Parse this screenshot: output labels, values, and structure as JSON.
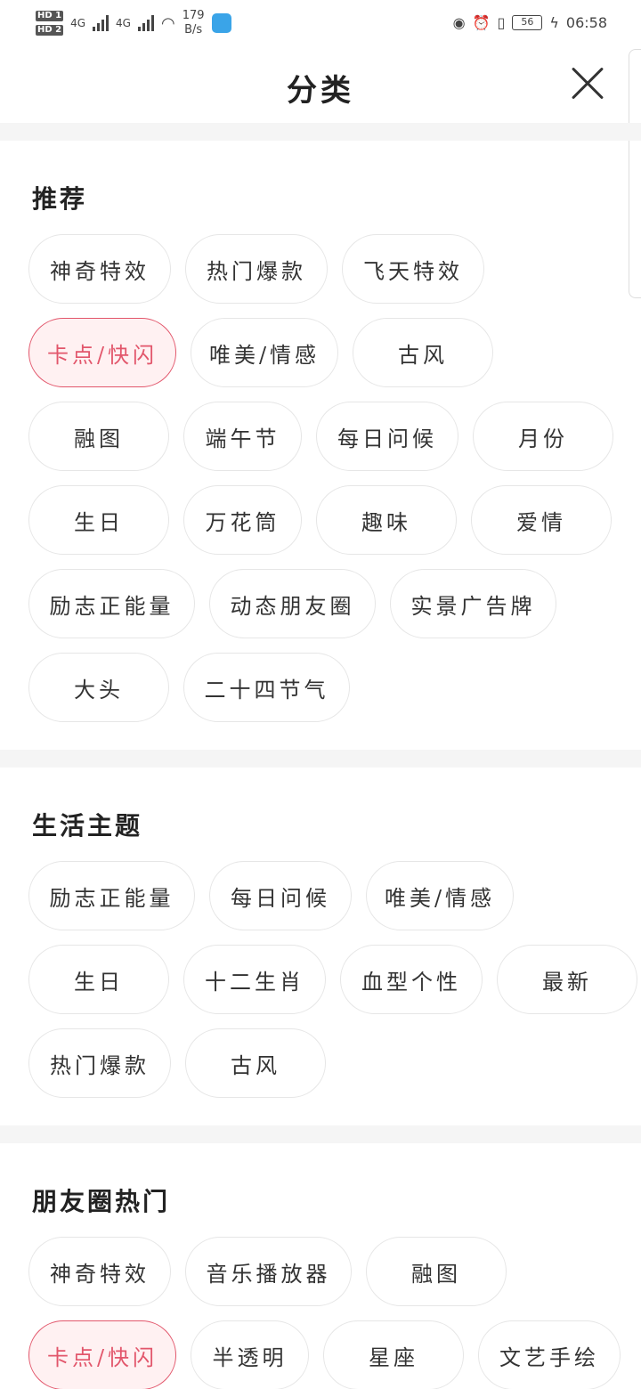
{
  "status_bar": {
    "hd1": "HD 1",
    "hd2": "HD 2",
    "net1": "4G",
    "net2": "4G",
    "speed_value": "179",
    "speed_unit": "B/s",
    "battery": "56",
    "time": "06:58"
  },
  "header": {
    "title": "分类"
  },
  "sections": [
    {
      "title": "推荐",
      "chips": [
        "神奇特效",
        "热门爆款",
        "飞天特效",
        "卡点/快闪",
        "唯美/情感",
        "古风",
        "融图",
        "端午节",
        "每日问候",
        "月份",
        "生日",
        "万花筒",
        "趣味",
        "爱情",
        "励志正能量",
        "动态朋友圈",
        "实景广告牌",
        "大头",
        "二十四节气"
      ]
    },
    {
      "title": "生活主题",
      "chips": [
        "励志正能量",
        "每日问候",
        "唯美/情感",
        "生日",
        "十二生肖",
        "血型个性",
        "最新",
        "热门爆款",
        "古风"
      ]
    },
    {
      "title": "朋友圈热门",
      "chips": [
        "神奇特效",
        "音乐播放器",
        "融图",
        "卡点/快闪",
        "半透明",
        "星座",
        "文艺手绘"
      ]
    }
  ],
  "selected_chip": "卡点/快闪",
  "colors": {
    "accent": "#e2566b",
    "accent_bg": "#fff1f2",
    "chip_border": "#e6e6e6",
    "divider": "#f5f5f5"
  }
}
